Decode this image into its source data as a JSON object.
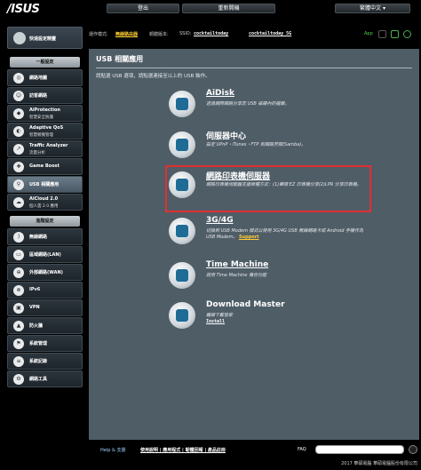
{
  "header": {
    "logo": "/ISUS",
    "logout_label": "登出",
    "reboot_label": "重新開機",
    "language_label": "繁體中文"
  },
  "status": {
    "mode_prefix": "運作模式:",
    "mode_value": "無線路由器",
    "firmware_prefix": "韌體版本:",
    "ssid_prefix": "SSID:",
    "ssid_1": "cocktailtoday",
    "ssid_2": "cocktailtoday_5G",
    "app_label": "App"
  },
  "quick_setup": {
    "label": "快速設定精靈"
  },
  "sidebar": {
    "general_header": "一般設定",
    "advanced_header": "進階設定",
    "general_items": [
      {
        "label": "網路地圖"
      },
      {
        "label": "訪客網路"
      },
      {
        "label": "AiProtection",
        "sub": "智慧安全防護"
      },
      {
        "label": "Adaptive QoS",
        "sub": "智慧頻寬管理"
      },
      {
        "label": "Traffic Analyzer",
        "sub": "流量分析"
      },
      {
        "label": "Game Boost"
      },
      {
        "label": "USB 相關應用"
      },
      {
        "label": "AiCloud 2.0",
        "sub": "個人雲 2.0 應用"
      }
    ],
    "advanced_items": [
      {
        "label": "無線網路"
      },
      {
        "label": "區域網路(LAN)"
      },
      {
        "label": "外部網路(WAN)"
      },
      {
        "label": "IPv6"
      },
      {
        "label": "VPN"
      },
      {
        "label": "防火牆"
      },
      {
        "label": "系統管理"
      },
      {
        "label": "系統記錄"
      },
      {
        "label": "網路工具"
      }
    ]
  },
  "main": {
    "title": "USB 相關應用",
    "description": "請點選 USB 選項，請點選連接至以上的 USB 裝作。",
    "features": [
      {
        "title": "AiDisk",
        "desc": "透過網際網路分享您 USB 磁碟內的檔案。"
      },
      {
        "title": "伺服器中心",
        "desc": "設定 UPnP・iTunes・FTP 和網路芳鄰(Samba)。"
      },
      {
        "title": "網路印表機伺服器",
        "desc": "網路印表機伺服器支援兩種方式：(1)華碩 EZ 印表機分享(2)LPR 分享印表機。"
      },
      {
        "title": "3G/4G",
        "desc": "切換到 USB Modem 模式以使用 3G/4G USB 無線網路卡或 Android 手機作為 USB Modem。",
        "link": "Support"
      },
      {
        "title": "Time Machine",
        "desc": "啟用 Time Machine 備份功能"
      },
      {
        "title": "Download Master",
        "desc": "離線下載管家",
        "link": "Install"
      }
    ]
  },
  "footer": {
    "help_label": "Help & 支援",
    "links": "使用說明 | 應用程式 | 韌體回報 | 產品註冊",
    "faq_label": "FAQ",
    "copyright": "2017 華碩電腦 華碩電腦股份有限公司"
  }
}
